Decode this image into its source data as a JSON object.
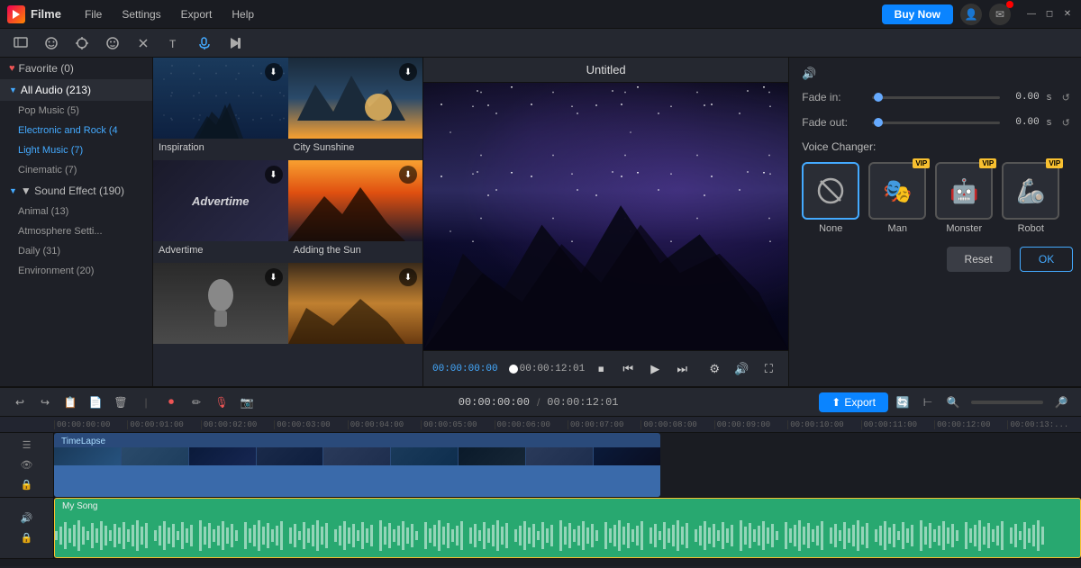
{
  "app": {
    "name": "Filme",
    "title": "Untitled"
  },
  "titlebar": {
    "menu": [
      "File",
      "Settings",
      "Export",
      "Help"
    ],
    "buy_label": "Buy Now",
    "win_controls": [
      "−",
      "□",
      "×"
    ]
  },
  "toolbar": {
    "icons": [
      "media",
      "face",
      "gear",
      "emoji",
      "scissors",
      "text",
      "music",
      "animation"
    ]
  },
  "sidebar": {
    "favorite": "Favorite (0)",
    "all_audio": "All Audio (213)",
    "items": [
      {
        "label": "Pop Music (5)",
        "indent": false
      },
      {
        "label": "Electronic and Rock (4",
        "indent": false
      },
      {
        "label": "Light Music (7)",
        "indent": false
      },
      {
        "label": "Cinematic (7)",
        "indent": false
      },
      {
        "label": "▼ Sound Effect (190)",
        "indent": false,
        "expanded": true
      },
      {
        "label": "Animal (13)",
        "indent": true
      },
      {
        "label": "Atmosphere Setti...",
        "indent": true
      },
      {
        "label": "Daily (31)",
        "indent": true
      },
      {
        "label": "Environment (20)",
        "indent": true
      }
    ]
  },
  "media_items": [
    {
      "title": "Inspiration",
      "bg": "1"
    },
    {
      "title": "City Sunshine",
      "bg": "2"
    },
    {
      "title": "Advertime",
      "bg": "3"
    },
    {
      "title": "Adding the Sun",
      "bg": "4"
    },
    {
      "title": "",
      "bg": "5"
    },
    {
      "title": "",
      "bg": "6"
    }
  ],
  "preview": {
    "title": "Untitled",
    "time_start": "00:00:00:00",
    "time_end": "00:00:12:01"
  },
  "right_panel": {
    "fade_in_label": "Fade in:",
    "fade_in_value": "0.00",
    "fade_in_unit": "s",
    "fade_out_label": "Fade out:",
    "fade_out_value": "0.00",
    "fade_out_unit": "s",
    "voice_changer_label": "Voice Changer:",
    "voice_options": [
      {
        "label": "None",
        "icon": "🚫",
        "selected": true,
        "vip": false
      },
      {
        "label": "Man",
        "icon": "🎭",
        "selected": false,
        "vip": true
      },
      {
        "label": "Monster",
        "icon": "🤖",
        "selected": false,
        "vip": true
      },
      {
        "label": "Robot",
        "icon": "🦾",
        "selected": false,
        "vip": true
      }
    ],
    "reset_label": "Reset",
    "ok_label": "OK"
  },
  "timeline": {
    "current_time": "00:00:00:00",
    "total_time": "00:00:12:01",
    "export_label": "Export",
    "ruler_marks": [
      "00:00:00:00",
      "00:00:01:00",
      "00:00:02:00",
      "00:00:03:00",
      "00:00:04:00",
      "00:00:05:00",
      "00:00:06:00",
      "00:00:07:00",
      "00:00:08:00",
      "00:00:09:00",
      "00:00:10:00",
      "00:00:11:00",
      "00:00:12:00",
      "00:00:13:..."
    ],
    "video_track_label": "TimeLapse",
    "audio_track_label": "My Song"
  }
}
